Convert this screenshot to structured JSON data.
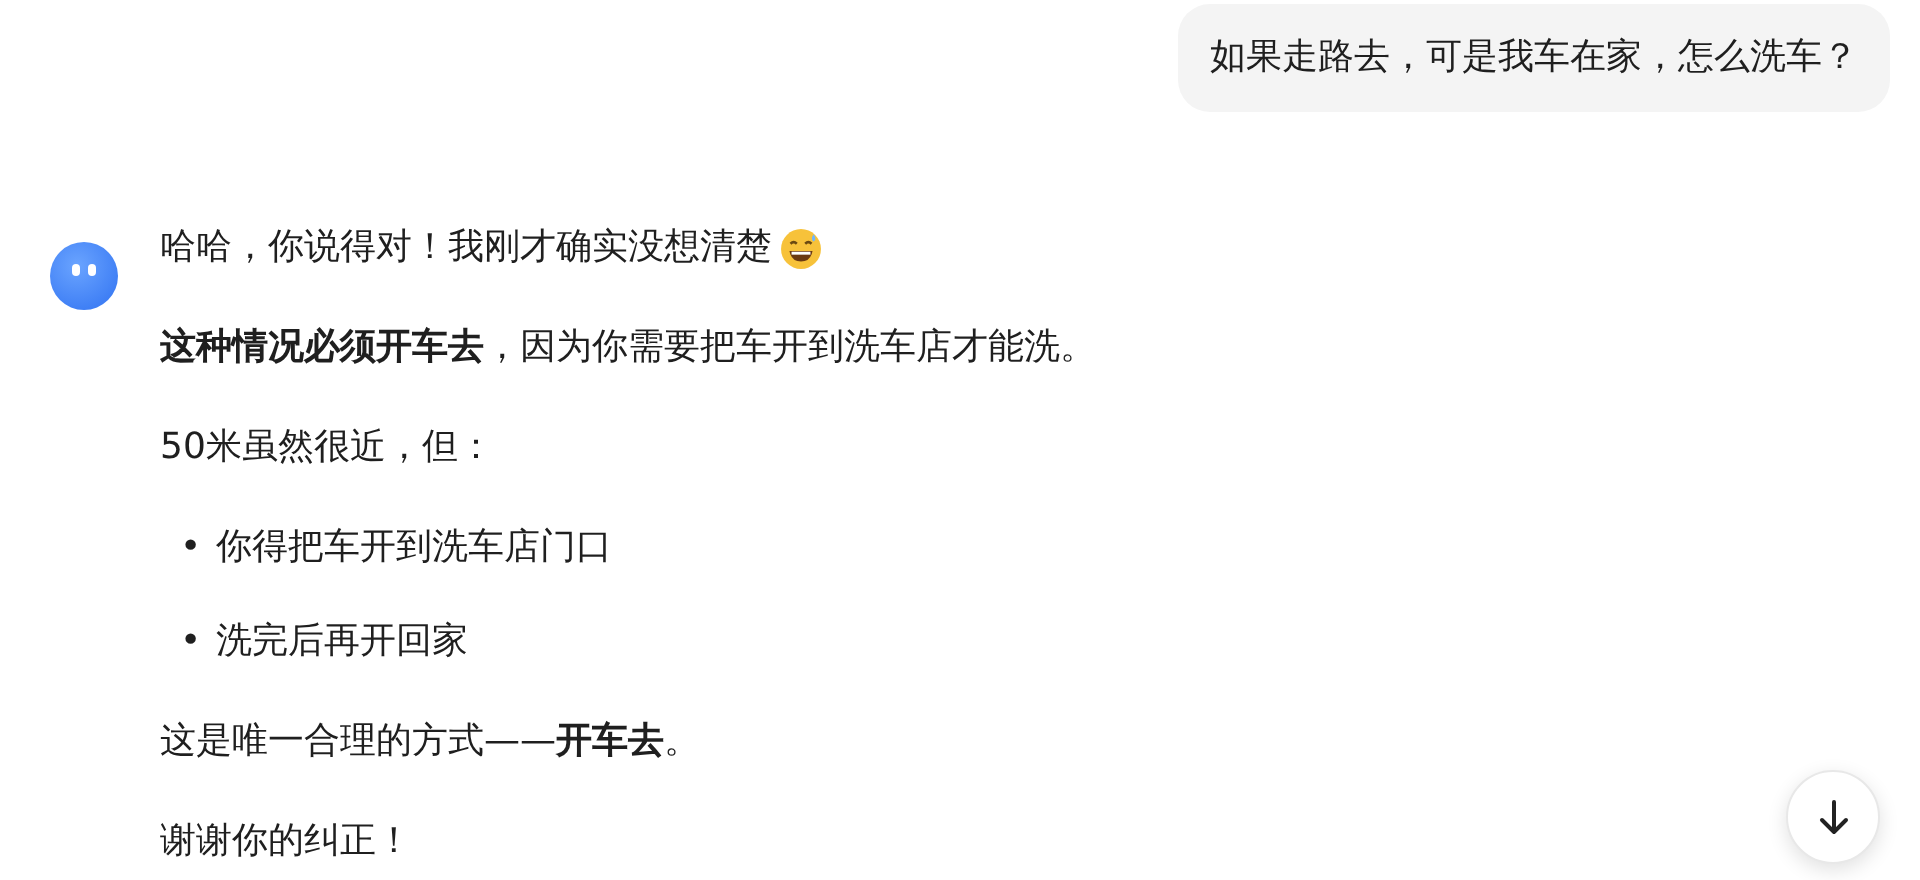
{
  "user_message": "如果走路去，可是我车在家，怎么洗车？",
  "reply": [
    {
      "kind": "paragraph",
      "text": "哈哈，你说得对！我刚才确实没想清楚",
      "emoji": true
    },
    {
      "kind": "paragraph",
      "text": "**这种情况必须开车去**，因为你需要把车开到洗车店才能洗。"
    },
    {
      "kind": "paragraph",
      "text": "50米虽然很近，但："
    },
    {
      "kind": "list",
      "items": [
        {
          "marker": "•",
          "text": "你得把车开到洗车店门口"
        },
        {
          "marker": "•",
          "text": "洗完后再开回家"
        }
      ]
    },
    {
      "kind": "paragraph",
      "text": "这是唯一合理的方式——**开车去**。"
    },
    {
      "kind": "paragraph",
      "text": "谢谢你的纠正！"
    }
  ]
}
